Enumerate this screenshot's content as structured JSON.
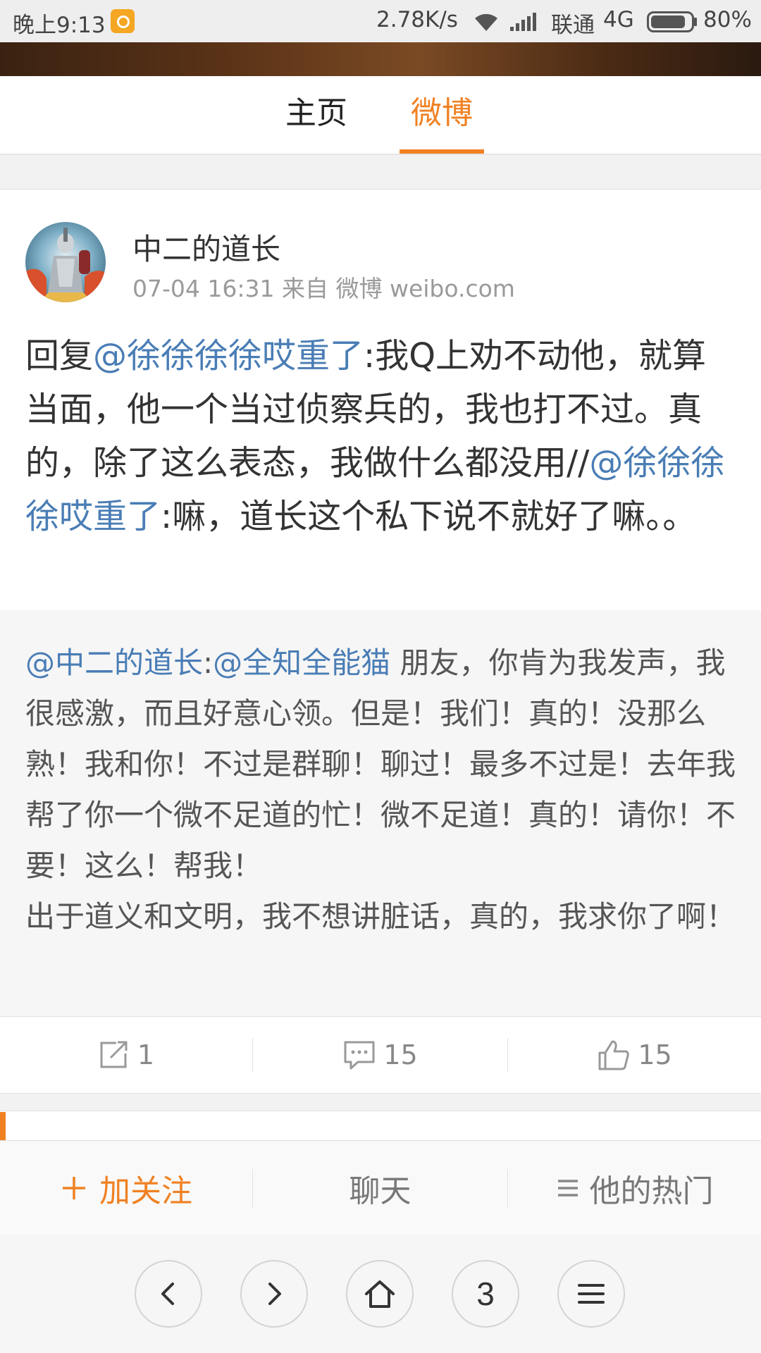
{
  "status_bar": {
    "time": "晚上9:13",
    "speed": "2.78K/s",
    "carrier": "联通",
    "network": "4G",
    "battery": "80%"
  },
  "tabs": [
    {
      "label": "主页",
      "active": false
    },
    {
      "label": "微博",
      "active": true
    }
  ],
  "accent_color": "#f08123",
  "link_color": "#4a7db5",
  "post": {
    "author": "中二的道长",
    "meta": "07-04 16:31 来自 微博 weibo.com",
    "text": {
      "p1": "回复",
      "m1": "@徐徐徐徐哎重了",
      "p2": ":我Q上劝不动他，就算当面，他一个当过侦察兵的，我也打不过。真的，除了这么表态，我做什么都没用//",
      "m2": "@徐徐徐徐哎重了",
      "p3": ":嘛，道长这个私下说不就好了嘛。。"
    }
  },
  "repost": {
    "author_mention": "@中二的道长",
    "colon": ":",
    "mention": "@全知全能猫",
    "body": " 朋友，你肯为我发声，我很感激，而且好意心领。但是！我们！真的！没那么熟！我和你！不过是群聊！聊过！最多不过是！去年我帮了你一个微不足道的忙！微不足道！真的！请你！不要！这么！帮我！",
    "body2": "出于道义和文明，我不想讲脏话，真的，我求你了啊！"
  },
  "actions": {
    "repost_count": "1",
    "comment_count": "15",
    "like_count": "15"
  },
  "follow_bar": {
    "follow_label": "加关注",
    "chat_label": "聊天",
    "hot_label": "他的热门"
  },
  "browser_nav": {
    "tab_count": "3"
  }
}
